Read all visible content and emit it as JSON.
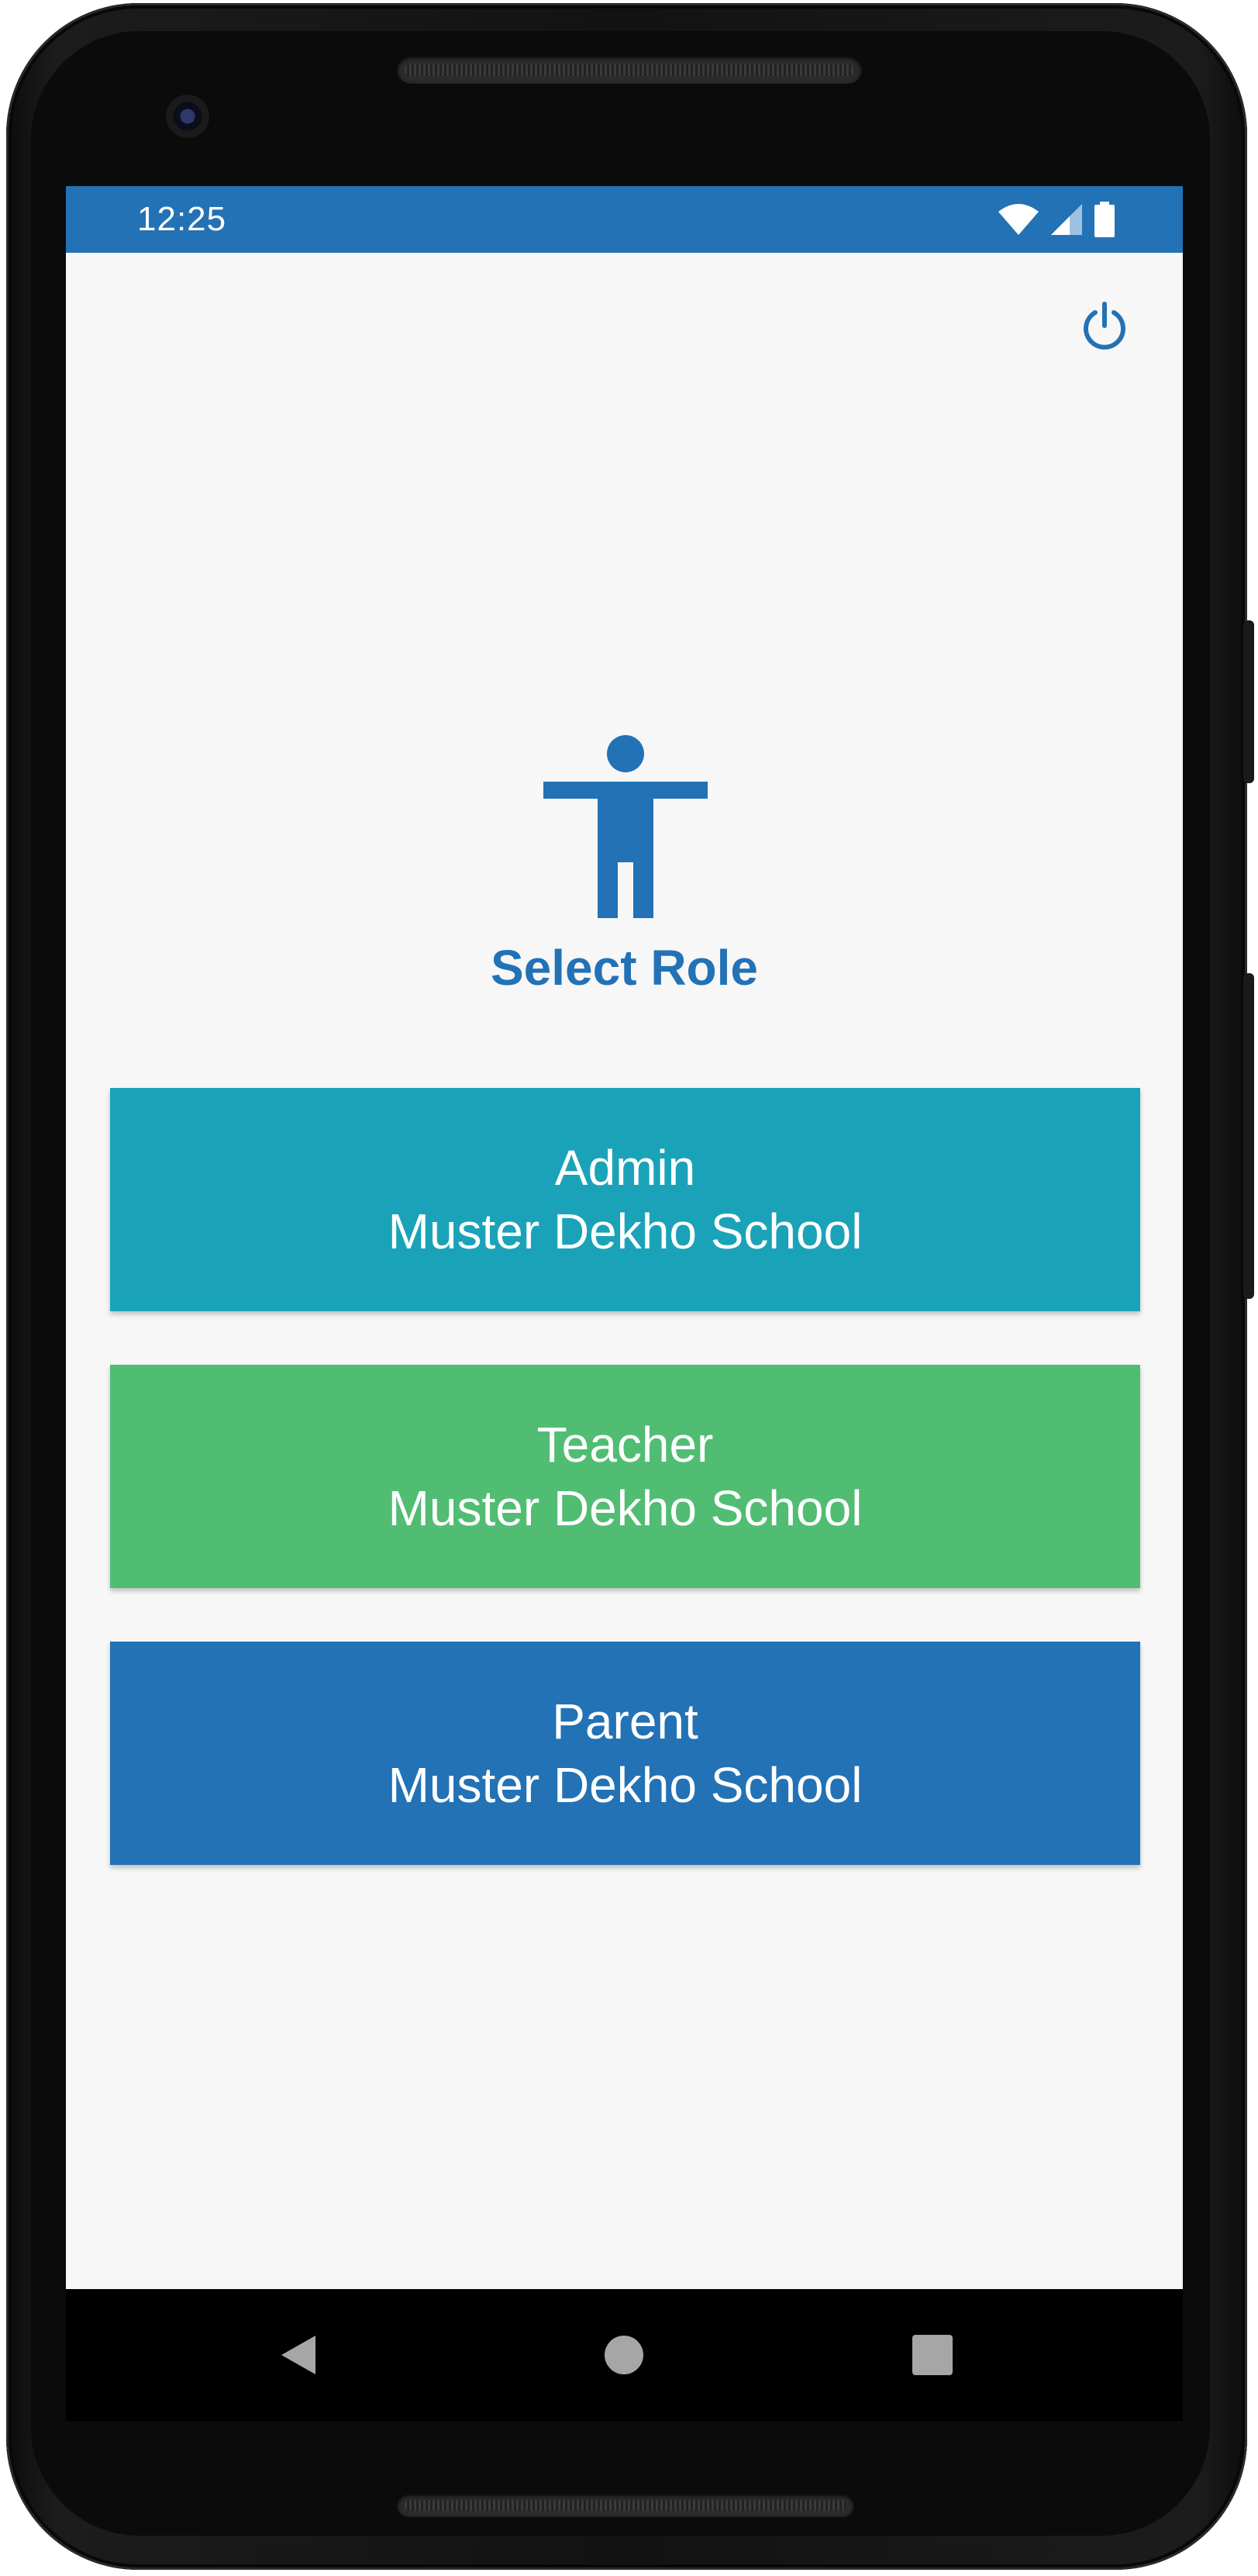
{
  "status_bar": {
    "time": "12:25",
    "icons": [
      "wifi-icon",
      "cellular-signal-icon",
      "battery-icon"
    ]
  },
  "header": {
    "power_icon": "power-icon"
  },
  "main": {
    "role_icon": "accessibility-person-icon",
    "title": "Select Role",
    "roles": [
      {
        "role": "Admin",
        "school": "Muster Dekho School",
        "color": "#1aa3b8"
      },
      {
        "role": "Teacher",
        "school": "Muster Dekho School",
        "color": "#50bd73"
      },
      {
        "role": "Parent",
        "school": "Muster Dekho School",
        "color": "#2272b5"
      }
    ]
  },
  "nav_bar": {
    "buttons": [
      "back-icon",
      "home-icon",
      "recents-icon"
    ]
  },
  "colors": {
    "accent": "#2272b5",
    "screen_background": "#f7f7f7",
    "status_bar": "#2272b5"
  }
}
